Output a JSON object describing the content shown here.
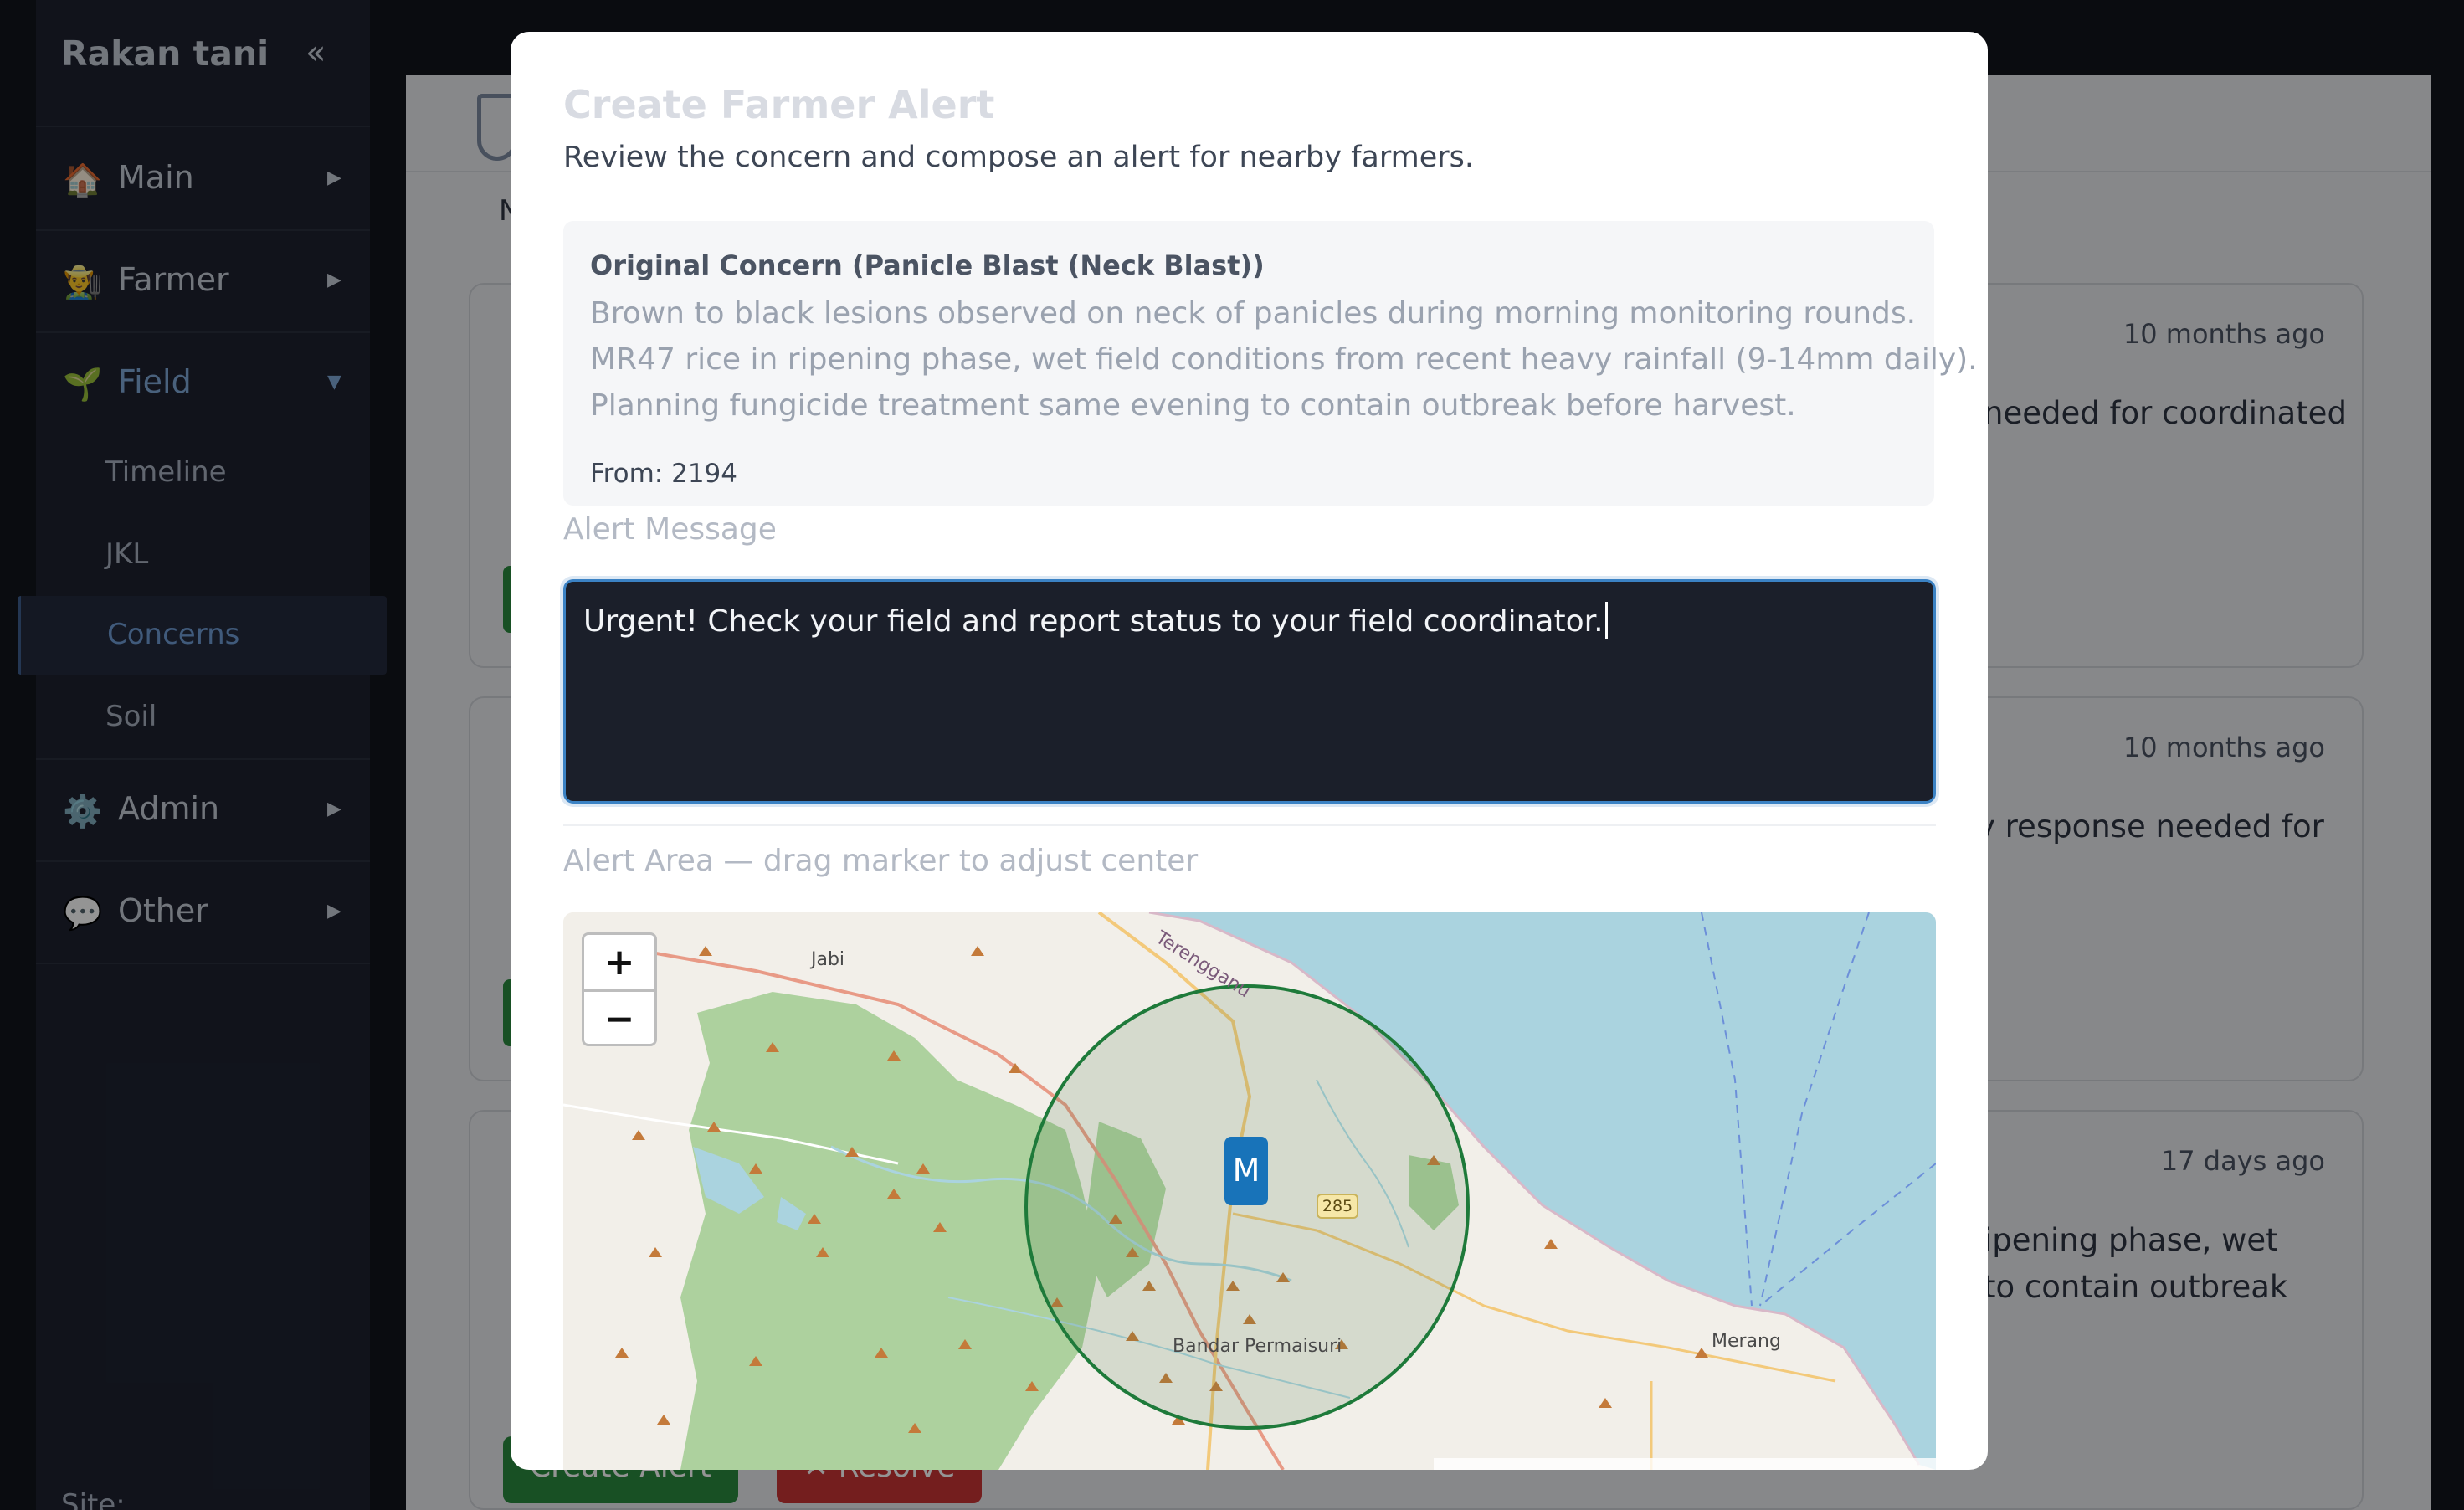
{
  "sidebar": {
    "brand": "Rakan tani",
    "collapse_icon": "«",
    "items": [
      {
        "label": "Main",
        "icon": "🏠",
        "arrow": "▶"
      },
      {
        "label": "Farmer",
        "icon": "👨‍🌾",
        "arrow": "▶"
      },
      {
        "label": "Field",
        "icon": "🌱",
        "arrow": "▼"
      },
      {
        "label": "Admin",
        "icon": "⚙️",
        "arrow": "▶"
      },
      {
        "label": "Other",
        "icon": "💬",
        "arrow": "▶"
      }
    ],
    "field_subitems": [
      "Timeline",
      "JKL",
      "Concerns",
      "Soil"
    ],
    "active_subitem": "Concerns",
    "site_label": "Site:"
  },
  "background": {
    "tab_fragment": "N",
    "cards": [
      {
        "time": "10 months ago",
        "text": "needed for coordinated"
      },
      {
        "time": "10 months ago",
        "text": "y response needed for"
      },
      {
        "time": "17 days ago",
        "text": "ipening phase, wet\nto contain outbreak"
      }
    ],
    "create_alert_label": "Create Alert",
    "resolve_label": "✕ Resolve"
  },
  "modal": {
    "title": "Create Farmer Alert",
    "subtitle": "Review the concern and compose an alert for nearby farmers.",
    "concern": {
      "heading": "Original Concern (Panicle Blast (Neck Blast))",
      "body_lines": [
        "Brown to black lesions observed on neck of panicles during morning monitoring rounds.",
        "MR47 rice in ripening phase, wet field conditions from recent heavy rainfall (9-14mm daily).",
        "Planning fungicide treatment same evening to contain outbreak before harvest."
      ],
      "from": "From: 2194"
    },
    "message_label": "Alert Message",
    "message_value": "Urgent! Check your field and report status to your field coordinator.",
    "area_label": "Alert Area — drag marker to adjust center",
    "map": {
      "zoom_in": "+",
      "zoom_out": "−",
      "marker_label": "M",
      "places": {
        "jabi": "Jabi",
        "bandar": "Bandar Permaisuri",
        "merang": "Merang",
        "terengganu": "Terengganu"
      },
      "road_number": "285",
      "colors": {
        "water": "#aad3df",
        "forest": "#add19e",
        "land": "#f2efe9",
        "circle": "#1e7a3a",
        "marker": "#1873b9"
      }
    }
  }
}
